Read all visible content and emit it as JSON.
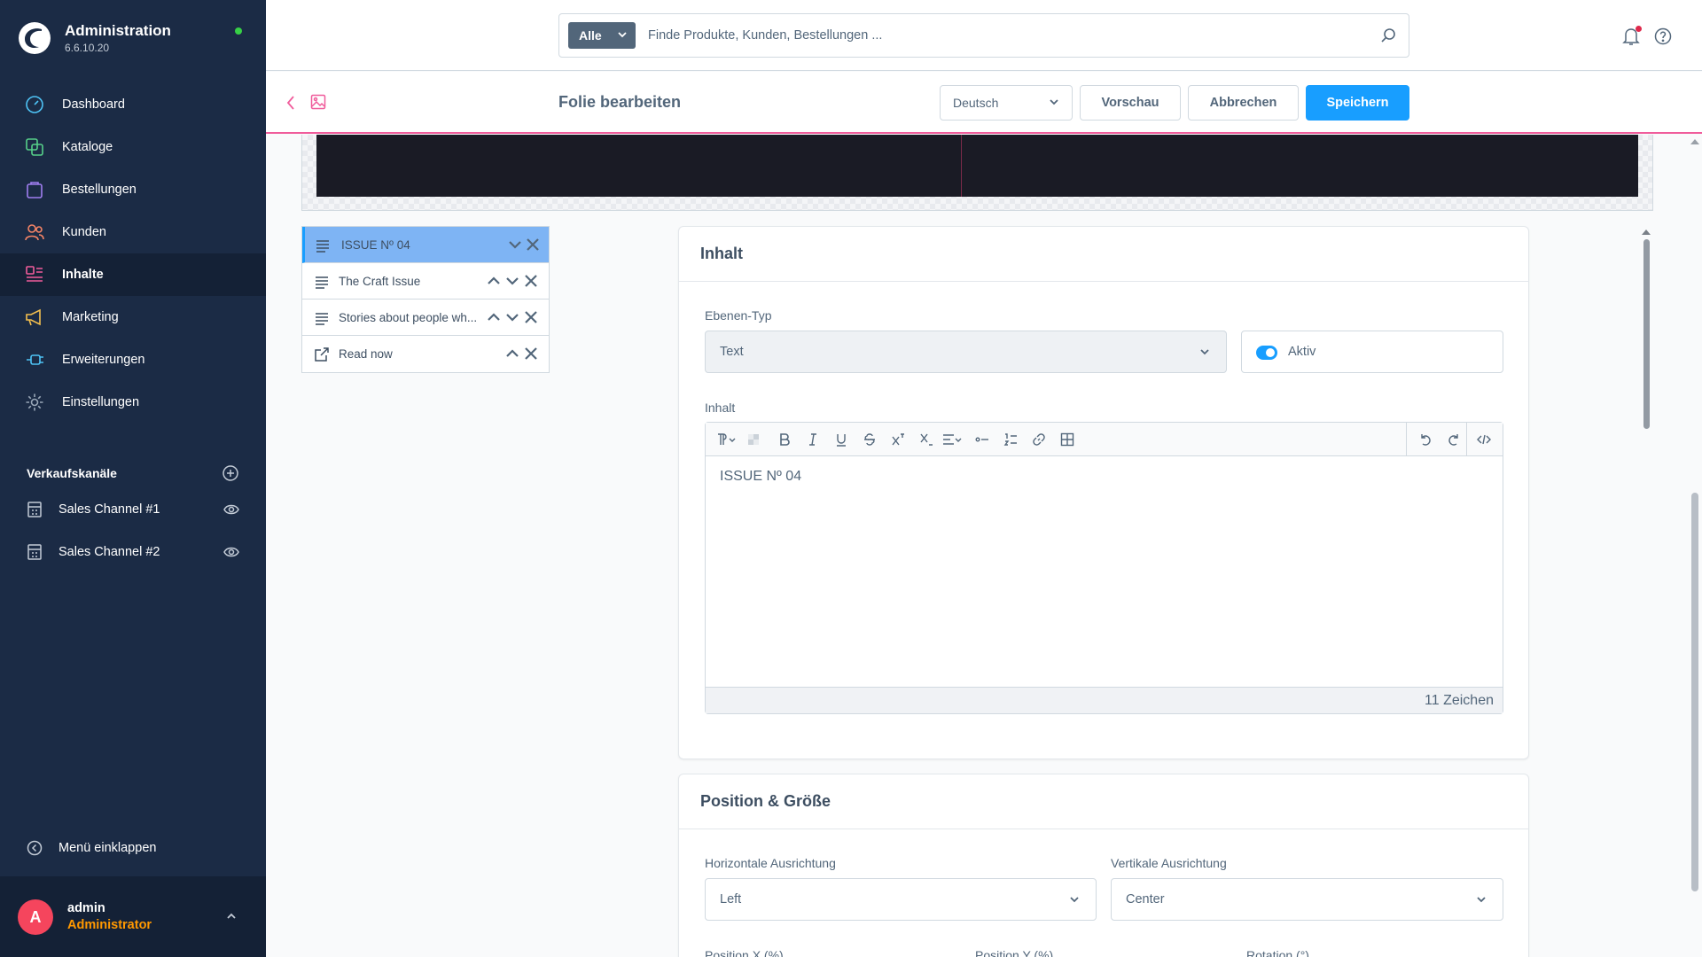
{
  "brand": {
    "title": "Administration",
    "version": "6.6.10.20"
  },
  "sidebar": {
    "items": [
      {
        "label": "Dashboard",
        "icon": "dashboard-icon"
      },
      {
        "label": "Kataloge",
        "icon": "catalog-icon"
      },
      {
        "label": "Bestellungen",
        "icon": "orders-icon"
      },
      {
        "label": "Kunden",
        "icon": "customers-icon"
      },
      {
        "label": "Inhalte",
        "icon": "content-icon",
        "active": true
      },
      {
        "label": "Marketing",
        "icon": "megaphone-icon"
      },
      {
        "label": "Erweiterungen",
        "icon": "plug-icon"
      },
      {
        "label": "Einstellungen",
        "icon": "gear-icon"
      }
    ],
    "channels_heading": "Verkaufskanäle",
    "channels": [
      {
        "label": "Sales Channel #1"
      },
      {
        "label": "Sales Channel #2"
      }
    ],
    "collapse_label": "Menü einklappen",
    "user": {
      "initial": "A",
      "name": "admin",
      "role": "Administrator"
    }
  },
  "topbar": {
    "search_type": "Alle",
    "search_placeholder": "Finde Produkte, Kunden, Bestellungen ..."
  },
  "smartbar": {
    "title": "Folie bearbeiten",
    "language": "Deutsch",
    "preview_label": "Vorschau",
    "cancel_label": "Abbrechen",
    "save_label": "Speichern"
  },
  "layers": [
    {
      "label": "ISSUE Nº 04",
      "icon": "text-layer-icon",
      "active": true
    },
    {
      "label": "The Craft Issue",
      "icon": "text-layer-icon"
    },
    {
      "label": "Stories about people wh...",
      "icon": "text-layer-icon"
    },
    {
      "label": "Read now",
      "icon": "link-layer-icon"
    }
  ],
  "content_card": {
    "title": "Inhalt",
    "layer_type_label": "Ebenen-Typ",
    "layer_type_value": "Text",
    "active_label": "Aktiv",
    "active": true,
    "content_label": "Inhalt",
    "editor_text": "ISSUE Nº 04",
    "char_count": "11 Zeichen"
  },
  "position_card": {
    "title": "Position & Größe",
    "h_align_label": "Horizontale Ausrichtung",
    "h_align_value": "Left",
    "v_align_label": "Vertikale Ausrichtung",
    "v_align_value": "Center",
    "pos_x_label": "Position X (%)",
    "pos_y_label": "Position Y (%)",
    "rotation_label": "Rotation (°)"
  },
  "colors": {
    "primary": "#189eff",
    "sidebar": "#1b2b45",
    "accent_line": "#f05c9b",
    "role": "#ff9800"
  }
}
